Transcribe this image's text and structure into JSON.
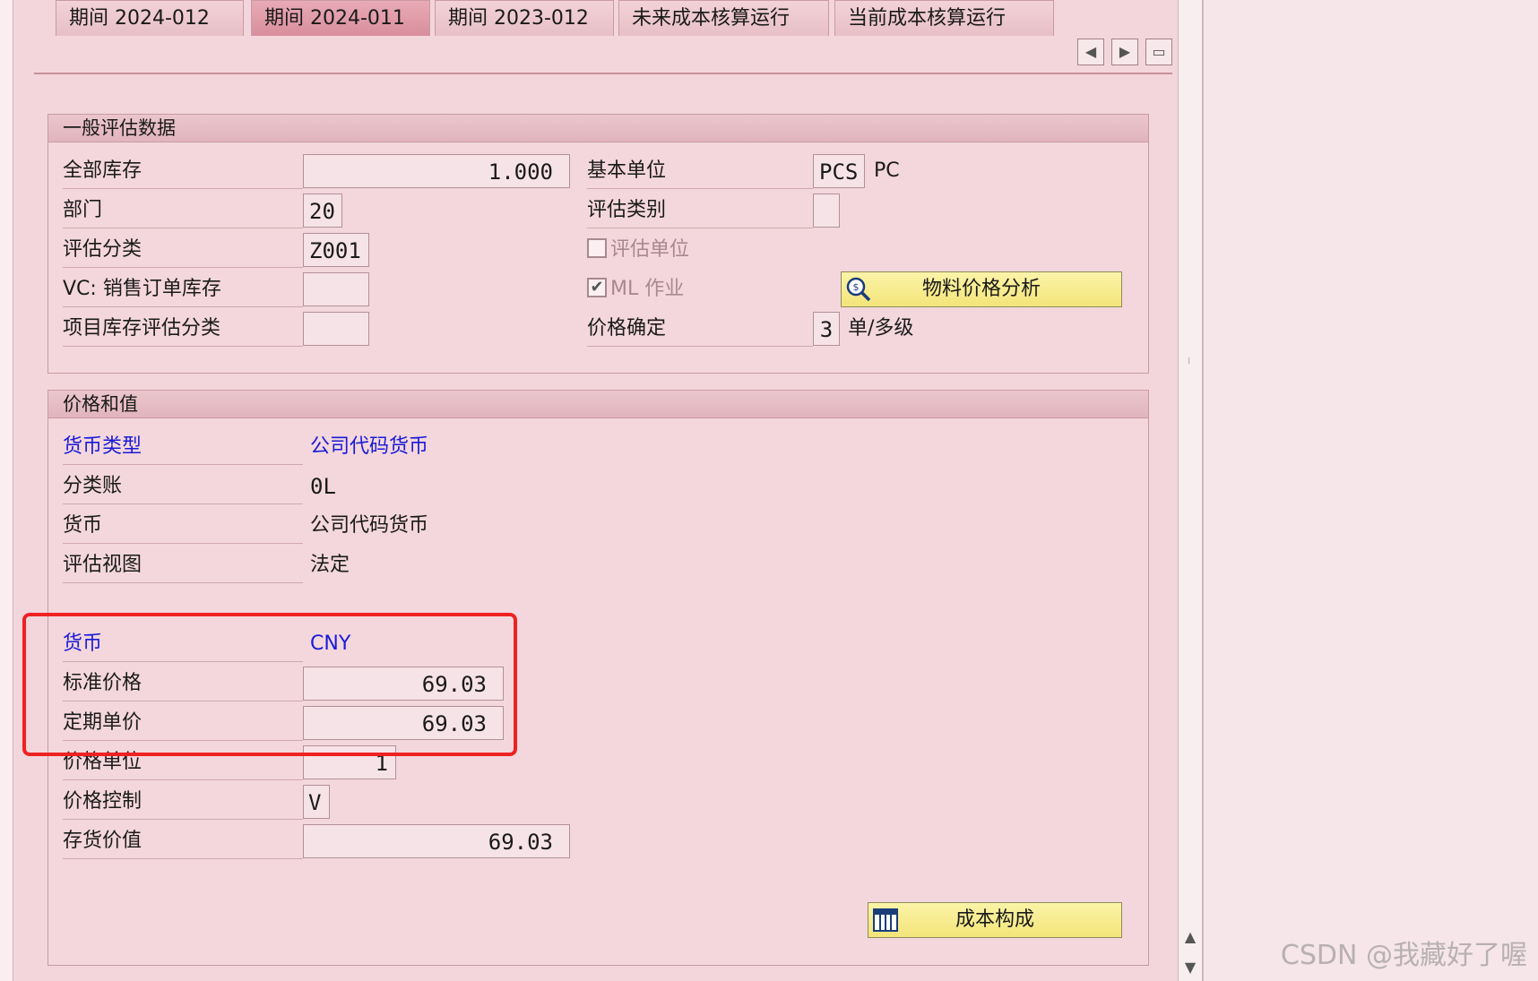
{
  "tabs": [
    {
      "label": "期间 2024-012",
      "active": false
    },
    {
      "label": "期间 2024-011",
      "active": true
    },
    {
      "label": "期间 2023-012",
      "active": false
    },
    {
      "label": "未来成本核算运行",
      "active": false
    },
    {
      "label": "当前成本核算运行",
      "active": false
    }
  ],
  "tab_nav_icons": [
    "scroll-left-icon",
    "scroll-right-icon",
    "tab-list-icon"
  ],
  "general": {
    "title": "一般评估数据",
    "total_stock_label": "全部库存",
    "total_stock_value": "1.000",
    "division_label": "部门",
    "division_value": "20",
    "valuation_class_label": "评估分类",
    "valuation_class_value": "Z001",
    "vc_label": "VC: 销售订单库存",
    "vc_value": "",
    "project_label": "项目库存评估分类",
    "project_value": "",
    "base_unit_label": "基本单位",
    "base_unit_value": "PCS",
    "base_unit_text": "PC",
    "valuation_category_label": "评估类别",
    "valuation_category_value": "",
    "valuated_unit_label": "评估单位",
    "valuated_unit_checked": false,
    "ml_label": "ML 作业",
    "ml_checked": true,
    "material_price_button": "物料价格分析",
    "price_determination_label": "价格确定",
    "price_determination_value": "3",
    "price_determination_text": "单/多级"
  },
  "prices": {
    "title": "价格和值",
    "currency_type_label": "货币类型",
    "currency_type_value": "公司代码货币",
    "ledger_label": "分类账",
    "ledger_value": "0L",
    "currency_label": "货币",
    "currency_value": "公司代码货币",
    "view_label": "评估视图",
    "view_value": "法定",
    "currency2_label": "货币",
    "currency2_value": "CNY",
    "std_price_label": "标准价格",
    "std_price_value": "69.03",
    "periodic_price_label": "定期单价",
    "periodic_price_value": "69.03",
    "price_unit_label": "价格单位",
    "price_unit_value": "1",
    "price_control_label": "价格控制",
    "price_control_value": "V",
    "inventory_value_label": "存货价值",
    "inventory_value_value": "69.03",
    "cost_component_button": "成本构成"
  },
  "watermark": "CSDN @我藏好了喔",
  "colors": {
    "accent_blue": "#1a1ad8",
    "highlight_red": "#ee2222",
    "button_yellow": "#f5e97e"
  }
}
